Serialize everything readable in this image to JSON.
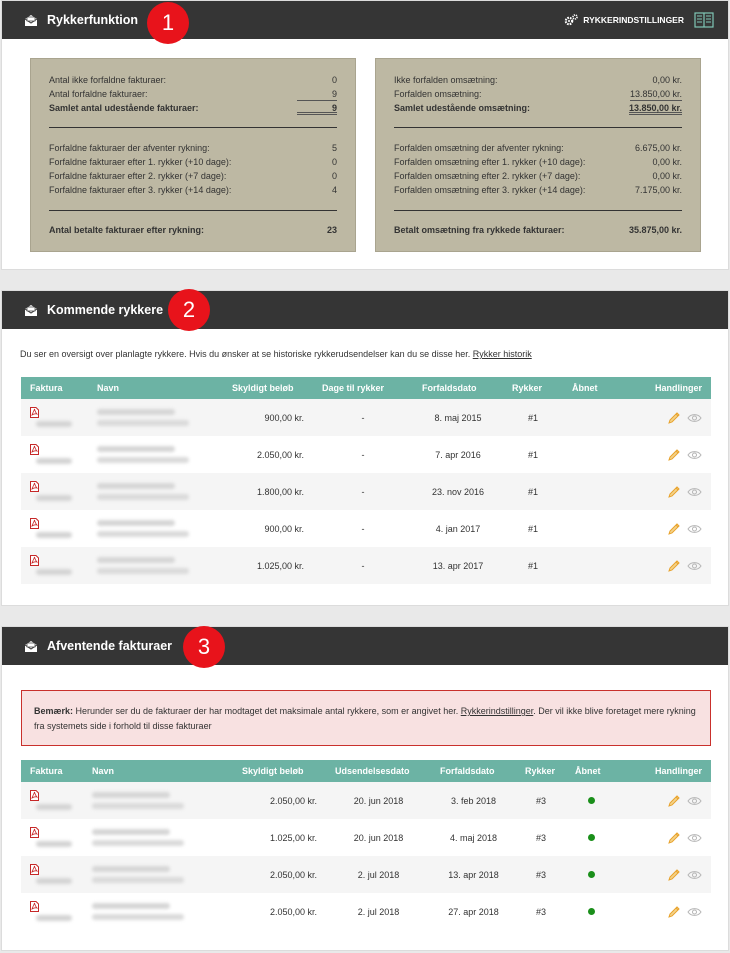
{
  "header1": {
    "title": "Rykkerfunktion",
    "settings": "RYKKERINDSTILLINGER",
    "badge": "1"
  },
  "statsLeft": {
    "r1": {
      "label": "Antal ikke forfaldne fakturaer:",
      "value": "0"
    },
    "r2": {
      "label": "Antal forfaldne fakturaer:",
      "value": "9"
    },
    "r3": {
      "label": "Samlet antal udestående fakturaer:",
      "value": "9"
    },
    "r4": {
      "label": "Forfaldne fakturaer der afventer rykning:",
      "value": "5"
    },
    "r5": {
      "label": "Forfaldne fakturaer efter 1. rykker (+10 dage):",
      "value": "0"
    },
    "r6": {
      "label": "Forfaldne fakturaer efter 2. rykker (+7 dage):",
      "value": "0"
    },
    "r7": {
      "label": "Forfaldne fakturaer efter 3. rykker (+14 dage):",
      "value": "4"
    },
    "r8": {
      "label": "Antal betalte fakturaer efter rykning:",
      "value": "23"
    }
  },
  "statsRight": {
    "r1": {
      "label": "Ikke forfalden omsætning:",
      "value": "0,00 kr."
    },
    "r2": {
      "label": "Forfalden omsætning:",
      "value": "13.850,00 kr."
    },
    "r3": {
      "label": "Samlet udestående omsætning:",
      "value": "13.850,00 kr."
    },
    "r4": {
      "label": "Forfalden omsætning der afventer rykning:",
      "value": "6.675,00 kr."
    },
    "r5": {
      "label": "Forfalden omsætning efter 1. rykker (+10 dage):",
      "value": "0,00 kr."
    },
    "r6": {
      "label": "Forfalden omsætning efter 2. rykker (+7 dage):",
      "value": "0,00 kr."
    },
    "r7": {
      "label": "Forfalden omsætning efter 3. rykker (+14 dage):",
      "value": "7.175,00 kr."
    },
    "r8": {
      "label": "Betalt omsætning fra rykkede fakturaer:",
      "value": "35.875,00 kr."
    }
  },
  "header2": {
    "title": "Kommende rykkere",
    "badge": "2"
  },
  "upcoming": {
    "description": "Du ser en oversigt over planlagte rykkere. Hvis du ønsker at se historiske rykkerudsendelser kan du se disse her.",
    "link": "Rykker historik",
    "columns": {
      "c1": "Faktura",
      "c2": "Navn",
      "c3": "Skyldigt beløb",
      "c4": "Dage til rykker",
      "c5": "Forfaldsdato",
      "c6": "Rykker",
      "c7": "Åbnet",
      "c8": "Handlinger"
    },
    "rows": [
      {
        "amount": "900,00 kr.",
        "days": "-",
        "due": "8. maj 2015",
        "reminder": "#1"
      },
      {
        "amount": "2.050,00 kr.",
        "days": "-",
        "due": "7. apr 2016",
        "reminder": "#1"
      },
      {
        "amount": "1.800,00 kr.",
        "days": "-",
        "due": "23. nov 2016",
        "reminder": "#1"
      },
      {
        "amount": "900,00 kr.",
        "days": "-",
        "due": "4. jan 2017",
        "reminder": "#1"
      },
      {
        "amount": "1.025,00 kr.",
        "days": "-",
        "due": "13. apr 2017",
        "reminder": "#1"
      }
    ]
  },
  "header3": {
    "title": "Afventende fakturaer",
    "badge": "3"
  },
  "pending": {
    "notice_bold": "Bemærk:",
    "notice_text1": " Herunder ser du de fakturaer der har modtaget det maksimale antal rykkere, som er angivet her. ",
    "notice_link": "Rykkerindstillinger",
    "notice_text2": ". Der vil ikke blive foretaget mere rykning fra systemets side i forhold til disse fakturaer",
    "columns": {
      "c1": "Faktura",
      "c2": "Navn",
      "c3": "Skyldigt beløb",
      "c4": "Udsendelsesdato",
      "c5": "Forfaldsdato",
      "c6": "Rykker",
      "c7": "Åbnet",
      "c8": "Handlinger"
    },
    "rows": [
      {
        "amount": "2.050,00 kr.",
        "sent": "20. jun 2018",
        "due": "3. feb 2018",
        "reminder": "#3"
      },
      {
        "amount": "1.025,00 kr.",
        "sent": "20. jun 2018",
        "due": "4. maj 2018",
        "reminder": "#3"
      },
      {
        "amount": "2.050,00 kr.",
        "sent": "2. jul 2018",
        "due": "13. apr 2018",
        "reminder": "#3"
      },
      {
        "amount": "2.050,00 kr.",
        "sent": "2. jul 2018",
        "due": "27. apr 2018",
        "reminder": "#3"
      }
    ]
  },
  "colors": {
    "header": "#353535",
    "tableHeader": "#6cb3a4",
    "badge": "#e8131b",
    "statBox": "#bdb8a3",
    "openedDot": "#1a8f1a"
  }
}
